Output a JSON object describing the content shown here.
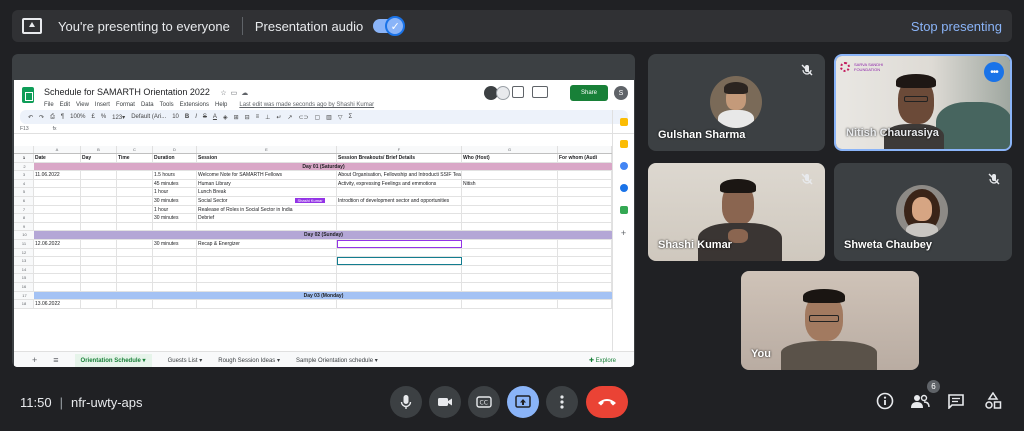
{
  "banner": {
    "presenting_text": "You're presenting to everyone",
    "audio_label": "Presentation audio",
    "stop_label": "Stop presenting"
  },
  "sheet": {
    "title": "Schedule for SAMARTH Orientation 2022",
    "menu": [
      "File",
      "Edit",
      "View",
      "Insert",
      "Format",
      "Data",
      "Tools",
      "Extensions",
      "Help"
    ],
    "last_edit": "Last edit was made seconds ago by Shashi Kumar",
    "share_label": "Share",
    "user_initial": "S",
    "toolbar": {
      "zoom": "100%",
      "font": "Default (Ari...",
      "size": "10"
    },
    "cell_ref": "F13",
    "col_headers": [
      "A",
      "B",
      "C",
      "D",
      "E",
      "F",
      "G",
      ""
    ],
    "header_row": [
      "Date",
      "Day",
      "Time",
      "Duration",
      "Session",
      "Session Breakouts/ Brief Details",
      "Who (Host)",
      "For whom (Audi"
    ],
    "day1": "Day 01 (Saturday)",
    "day2": "Day 02 (Sunday)",
    "day3": "Day 03 (Monday)",
    "rows_day1": [
      {
        "date": "11.06.2022",
        "duration": "1.5 hours",
        "session": "Welcome Note for SAMARTH Fellows",
        "details": "About Organisation, Fellowship and Introducti SSIF Team",
        "host": ""
      },
      {
        "date": "",
        "duration": "45 minutes",
        "session": "Human Library",
        "details": "Activity, expressing Feelings and emmotions",
        "host": "Nitish"
      },
      {
        "date": "",
        "duration": "1 hour",
        "session": "Lunch Break",
        "details": "",
        "host": ""
      },
      {
        "date": "",
        "duration": "30 minutes",
        "session": "Social Sector",
        "details": "Introdtion of development sector and opportunities",
        "host": ""
      },
      {
        "date": "",
        "duration": "1 hour",
        "session": "Realease of Roles in Social Sector in India",
        "details": "",
        "host": ""
      },
      {
        "date": "",
        "duration": "30 minutes",
        "session": "Debrief",
        "details": "",
        "host": ""
      }
    ],
    "rows_day2": [
      {
        "date": "12.06.2022",
        "duration": "30 minutes",
        "session": "Recap & Energizer",
        "details": "",
        "host": ""
      }
    ],
    "day3_date": "13.06.2022",
    "cursor_chip": "Shashi Kumar",
    "tabs": [
      "Orientation Schedule",
      "Guests List",
      "Rough Session Ideas",
      "Sample Orientation schedule"
    ],
    "explore_label": "Explore"
  },
  "participants": [
    {
      "name": "Gulshan Sharma",
      "muted": true
    },
    {
      "name": "Nitish Chaurasiya",
      "muted": false,
      "org_text": "SARVA SANDHI FOUNDATION"
    },
    {
      "name": "Shashi Kumar",
      "muted": true
    },
    {
      "name": "Shweta Chaubey",
      "muted": true
    },
    {
      "name": "You",
      "muted": false
    }
  ],
  "bottom": {
    "time": "11:50",
    "meeting_code": "nfr-uwty-aps",
    "people_count": "6"
  },
  "colors": {
    "background": "#202124",
    "tile": "#3c4043",
    "accent": "#8ab4f8",
    "end_call": "#ea4335",
    "sheets_green": "#188038"
  }
}
